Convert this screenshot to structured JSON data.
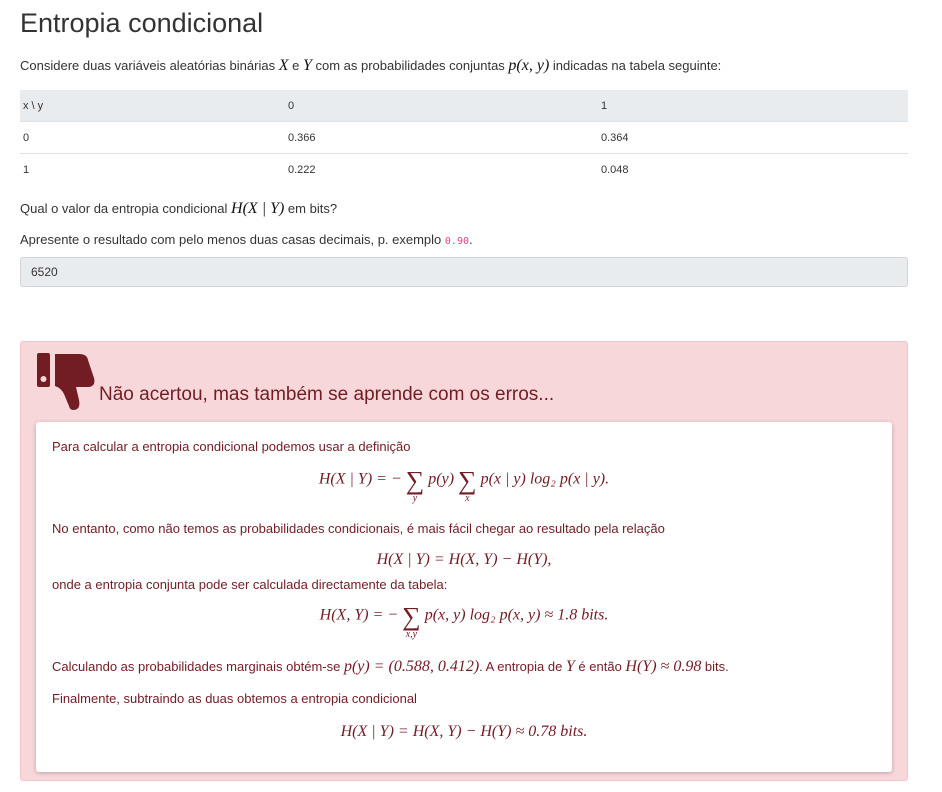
{
  "page": {
    "title": "Entropia condicional",
    "intro_before": "Considere duas variáveis aleatórias binárias ",
    "var_x": "X",
    "conj_e": " e ",
    "var_y": "Y",
    "intro_mid": " com as probabilidades conjuntas ",
    "intro_pxy": "p(x, y)",
    "intro_after": " indicadas na tabela seguinte:"
  },
  "table": {
    "headers": [
      "x \\ y",
      "0",
      "1"
    ],
    "rows": [
      [
        "0",
        "0.366",
        "0.364"
      ],
      [
        "1",
        "0.222",
        "0.048"
      ]
    ]
  },
  "question": {
    "text_before": "Qual o valor da entropia condicional ",
    "expr": "H(X | Y)",
    "text_after": " em bits?",
    "hint_before": "Apresente o resultado com pelo menos duas casas decimais, p. exemplo ",
    "hint_code": "0.90",
    "hint_after": "."
  },
  "answer": {
    "value": "6520"
  },
  "feedback": {
    "heading": "Não acertou, mas também se aprende com os erros...",
    "icon": "thumbs-down-icon",
    "colors": {
      "bg": "#f8d7da",
      "text": "#721c24"
    },
    "p1": "Para calcular a entropia condicional podemos usar a definição",
    "eq1": {
      "lhs": "H(X | Y) = −",
      "sub_y": "y",
      "mid": "p(y)",
      "sub_x": "x",
      "rhs": "p(x | y) log₂ p(x | y)."
    },
    "p2": "No entanto, como não temos as probabilidades condicionais, é mais fácil chegar ao resultado pela relação",
    "eq2": "H(X | Y) = H(X, Y) − H(Y),",
    "p3": "onde a entropia conjunta pode ser calculada directamente da tabela:",
    "eq3": {
      "lhs": "H(X, Y) = −",
      "sub": "x,y",
      "rhs": "p(x, y) log₂ p(x, y) ≈ 1.8 bits."
    },
    "p4_before": "Calculando as probabilidades marginais obtém-se ",
    "p4_py": "p(y) = (0.588, 0.412)",
    "p4_mid": ". A entropia de ",
    "p4_var": "Y",
    "p4_mid2": " é então ",
    "p4_hy": "H(Y) ≈ 0.98",
    "p4_after": " bits.",
    "p5": "Finalmente, subtraindo as duas obtemos a entropia condicional",
    "eq4": "H(X | Y) = H(X, Y) − H(Y) ≈ 0.78 bits."
  }
}
